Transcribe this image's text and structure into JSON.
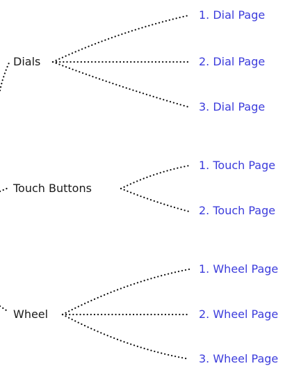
{
  "colors": {
    "link": "#3c3cdc",
    "text": "#1a1a1a",
    "connector": "#111111",
    "background": "#ffffff"
  },
  "groups": [
    {
      "label": "Dials",
      "pages": [
        "1. Dial Page",
        "2. Dial Page",
        "3. Dial Page"
      ]
    },
    {
      "label": "Touch Buttons",
      "pages": [
        "1. Touch Page",
        "2. Touch Page"
      ]
    },
    {
      "label": "Wheel",
      "pages": [
        "1. Wheel Page",
        "2. Wheel Page",
        "3. Wheel Page"
      ]
    }
  ]
}
